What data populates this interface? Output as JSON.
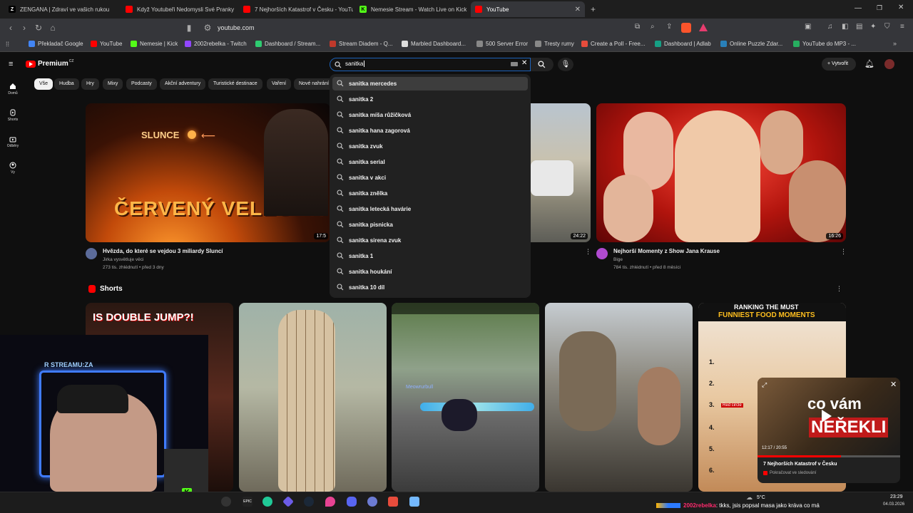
{
  "browser": {
    "tabs": [
      {
        "label": "ZENGANA | Zdraví ve vašich rukou",
        "icon": "z-icon"
      },
      {
        "label": "Když Youtubeři Nedomysli Své Pranky",
        "icon": "youtube-icon"
      },
      {
        "label": "7 Nejhorších Katastrof v Česku - YouTube",
        "icon": "youtube-icon"
      },
      {
        "label": "Nemesie Stream - Watch Live on Kick",
        "icon": "kick-icon"
      },
      {
        "label": "YouTube",
        "icon": "youtube-icon"
      }
    ],
    "url": "youtube.com",
    "bookmarks": [
      "Překladač Google",
      "YouTube",
      "Nemesie | Kick",
      "2002rebelka - Twitch",
      "Dashboard / Stream...",
      "Stream Diadem - Q...",
      "Marbled Dashboard...",
      "500 Server Error",
      "Tresty rumy",
      "Create a Poll - Free...",
      "Dashboard | Adlab",
      "Online Puzzle Zdar...",
      "YouTube do MP3 - ..."
    ]
  },
  "youtube": {
    "logo": "Premium",
    "logo_region": "CZ",
    "create_label": "Vytvořit",
    "search": {
      "query": "sanitka",
      "suggestions": [
        "sanitka mercedes",
        "sanitka 2",
        "sanitka míša růžičková",
        "sanitka hana zagorová",
        "sanitka zvuk",
        "sanitka serial",
        "sanitka v akci",
        "sanitka znělka",
        "sanitka letecká havárie",
        "sanitka pisnicka",
        "sanitka sirena zvuk",
        "sanitka 1",
        "sanitka houkání",
        "sanitka 10 díl"
      ]
    },
    "sidebar": [
      {
        "label": "Domů"
      },
      {
        "label": "Shorts"
      },
      {
        "label": "Odběry"
      },
      {
        "label": "Vy"
      }
    ],
    "chips": [
      "Vše",
      "Hudba",
      "Hry",
      "Mixy",
      "Podcasty",
      "Akční adventury",
      "Turistické destinace",
      "Vaření",
      "Nové nahrání"
    ],
    "videos": [
      {
        "title": "Hvězda, do které se vejdou 3 miliardy Sluncí",
        "channel": "Jirka vysvětluje věci",
        "meta": "273 tis. zhlédnutí • před 3 dny",
        "duration": "17:5",
        "thumb_text_1": "SLUNCE",
        "thumb_text_2": "ČERVENÝ VELEOBR"
      },
      {
        "duration": "24:22"
      },
      {
        "title": "Nejhorší Momenty z Show Jana Krause",
        "channel": "Bige",
        "meta": "784 tis. zhlédnutí • před 8 měsíci",
        "duration": "16:26"
      }
    ],
    "shorts_label": "Shorts",
    "shorts": [
      {
        "overlay_text": "IS DOUBLE JUMP?!"
      },
      {
        "overlay_text": ""
      },
      {
        "overlay_text": "Meowrurbull"
      },
      {
        "overlay_text": ""
      },
      {
        "overlay_text_1": "RANKING THE MUST",
        "overlay_text_2": "FUNNIEST FOOD MOMENTS",
        "ranks": [
          "1.",
          "2.",
          "3.",
          "4.",
          "5.",
          "6."
        ],
        "tag": "Red circle"
      }
    ],
    "miniplayer": {
      "title": "7 Nejhorších Katastrof v Česku",
      "time": "12:17 / 20:55",
      "status": "Pokračovat ve sledování",
      "overlay_text_1": "co vám",
      "overlay_text_2": "NEŘEKLI"
    }
  },
  "stream_overlay": {
    "webcam_text": "R STREAMU:ZA",
    "chat_user": "2002rebelka",
    "chat_message": ": tkks, jsis popsal masa jako kráva co má"
  },
  "taskbar": {
    "weather": "5°C",
    "time": "23:29",
    "date": "04.03.2026"
  },
  "colors": {
    "yt_red": "#ff0000",
    "kick_green": "#53fc18",
    "search_focus": "#1c62b9",
    "chat_user": "#ff2a6d"
  }
}
